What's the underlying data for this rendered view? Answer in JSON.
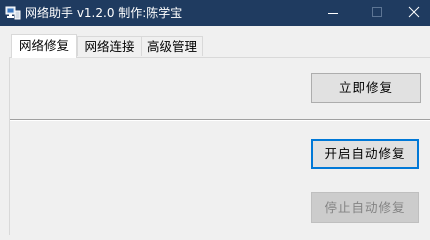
{
  "window": {
    "title": "网络助手 v1.2.0 制作:陈学宝",
    "title_bar_color": "#1f3b60",
    "icon": "network-computer-icon"
  },
  "tabs": [
    {
      "label": "网络修复",
      "selected": true
    },
    {
      "label": "网络连接",
      "selected": false
    },
    {
      "label": "高级管理",
      "selected": false
    }
  ],
  "buttons": {
    "repair_now": "立即修复",
    "start_auto_repair": "开启自动修复",
    "stop_auto_repair": "停止自动修复"
  },
  "colors": {
    "focus_border": "#0078d7",
    "disabled_text": "#838383"
  }
}
